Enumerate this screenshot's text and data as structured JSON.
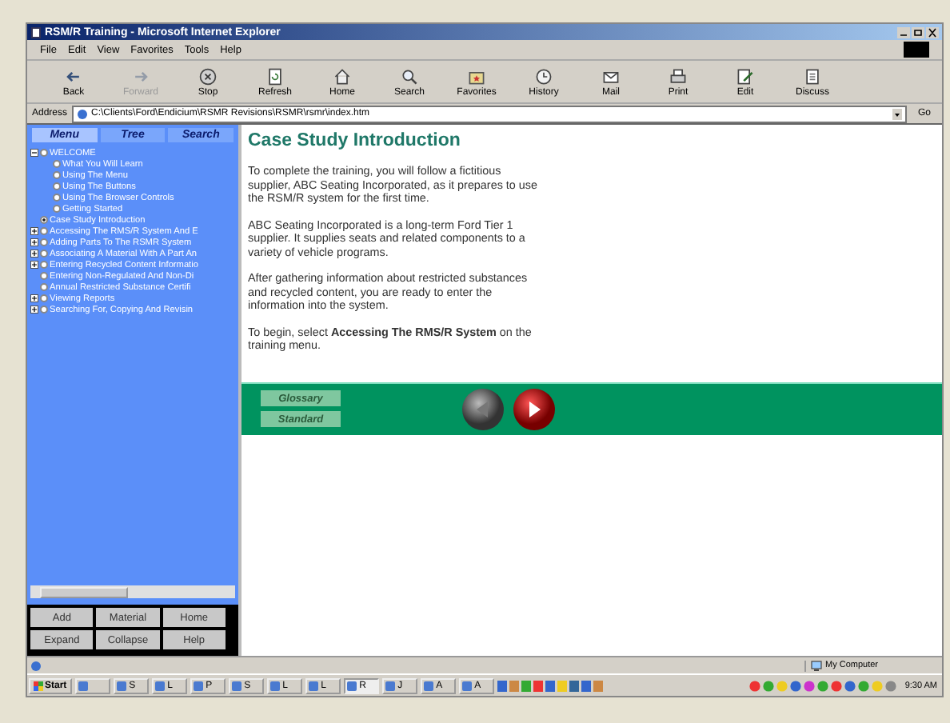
{
  "window": {
    "title": "RSM/R Training - Microsoft Internet Explorer"
  },
  "menu_bar": [
    "File",
    "Edit",
    "View",
    "Favorites",
    "Tools",
    "Help"
  ],
  "toolbar": [
    {
      "label": "Back",
      "kind": "back",
      "disabled": false
    },
    {
      "label": "Forward",
      "kind": "forward",
      "disabled": true
    },
    {
      "label": "Stop",
      "kind": "stop",
      "disabled": false
    },
    {
      "label": "Refresh",
      "kind": "refresh",
      "disabled": false
    },
    {
      "label": "Home",
      "kind": "home",
      "disabled": false
    },
    {
      "label": "Search",
      "kind": "search",
      "disabled": false
    },
    {
      "label": "Favorites",
      "kind": "favorites",
      "disabled": false
    },
    {
      "label": "History",
      "kind": "history",
      "disabled": false
    },
    {
      "label": "Mail",
      "kind": "mail",
      "disabled": false
    },
    {
      "label": "Print",
      "kind": "print",
      "disabled": false
    },
    {
      "label": "Edit",
      "kind": "edit",
      "disabled": false
    },
    {
      "label": "Discuss",
      "kind": "discuss",
      "disabled": false
    }
  ],
  "address_bar": {
    "label": "Address",
    "value": "C:\\Clients\\Ford\\Endicium\\RSMR Revisions\\RSMR\\rsmr\\index.htm",
    "go": "Go"
  },
  "sidebar": {
    "tabs": [
      {
        "label": "Menu",
        "selected": true
      },
      {
        "label": "Tree",
        "selected": false
      },
      {
        "label": "Search",
        "selected": false
      }
    ],
    "tree": [
      {
        "label": "WELCOME",
        "selected": false,
        "expanded": true,
        "children": [
          {
            "label": "What You Will Learn",
            "selected": false
          },
          {
            "label": "Using The Menu",
            "selected": false
          },
          {
            "label": "Using The Buttons",
            "selected": false
          },
          {
            "label": "Using The Browser Controls",
            "selected": false
          },
          {
            "label": "Getting Started",
            "selected": false
          }
        ]
      },
      {
        "label": "Case Study Introduction",
        "selected": true
      },
      {
        "label": "Accessing The RMS/R System And E",
        "selected": false,
        "expanded": false
      },
      {
        "label": "Adding Parts To The RSMR System",
        "selected": false,
        "expanded": false
      },
      {
        "label": "Associating A Material With A Part An",
        "selected": false,
        "expanded": false
      },
      {
        "label": "Entering Recycled Content Informatio",
        "selected": false,
        "expanded": false
      },
      {
        "label": "Entering Non-Regulated And Non-Di",
        "selected": false
      },
      {
        "label": "Annual Restricted Substance Certifi",
        "selected": false
      },
      {
        "label": "Viewing Reports",
        "selected": false,
        "expanded": false
      },
      {
        "label": "Searching For, Copying And Revisin",
        "selected": false,
        "expanded": false
      }
    ],
    "buttons": [
      "Add",
      "Material",
      "Home",
      "Expand",
      "Collapse",
      "Help"
    ]
  },
  "content": {
    "title": "Case Study Introduction",
    "paragraphs": [
      "To complete the training, you will follow a fictitious supplier, ABC Seating Incorporated, as it prepares to use the RSM/R system for the first time.",
      "ABC Seating Incorporated is a long-term Ford Tier 1 supplier. It supplies seats and related components to a variety of vehicle programs.",
      "After gathering information about restricted substances and recycled content, you are ready to enter the information into the system.",
      "To begin, select **Accessing The RMS/R System** on the training menu."
    ],
    "nav_bar": {
      "buttons": [
        "Glossary",
        "Standard"
      ],
      "back_disabled": true
    }
  },
  "status_bar": {
    "zone": "My Computer"
  },
  "taskbar": {
    "start": "Start",
    "tasks": [
      {
        "selected": false
      },
      {
        "label": "S",
        "selected": false
      },
      {
        "label": "L",
        "selected": false
      },
      {
        "label": "P",
        "selected": false
      },
      {
        "label": "S",
        "selected": false
      },
      {
        "label": "L",
        "selected": false
      },
      {
        "label": "L",
        "selected": false
      },
      {
        "label": "R",
        "selected": true
      },
      {
        "label": "J",
        "selected": false
      },
      {
        "label": "A",
        "selected": false
      },
      {
        "label": "A",
        "selected": false
      }
    ],
    "clock": "9:30 AM"
  }
}
